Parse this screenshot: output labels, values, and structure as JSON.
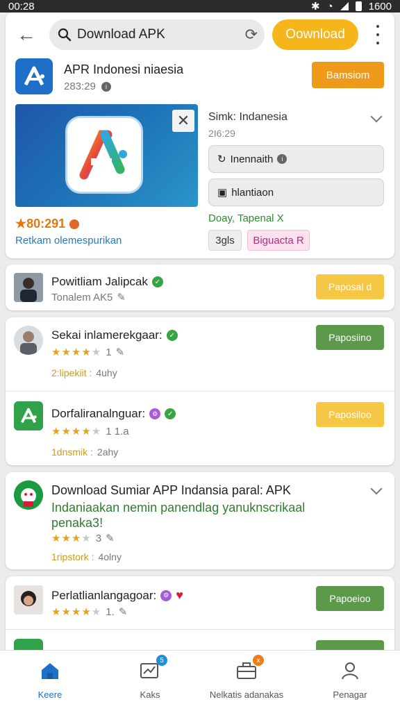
{
  "status_bar": {
    "time": "00:28",
    "battery_text": "1600"
  },
  "top_bar": {
    "search_value": "Download APK",
    "download_label": "Oownload"
  },
  "app": {
    "title": "APR Indonesi niaesia",
    "meta": "283:29",
    "action_label": "Bamsiom",
    "rating_text": "★80:291",
    "subtitle_link": "Retkam olemespurikan",
    "info_title": "Simk: Indanesia",
    "info_sub": "2I6:29",
    "field1": "Inennaith",
    "field2": "hlantiaon",
    "status_text": "Doay, Tapenal X",
    "chip1": "3gls",
    "chip2": "Biguacta R"
  },
  "list": [
    {
      "title": "Powitliam Jalipcak",
      "sub": "Tonalem AK5",
      "action": "Paposal d",
      "action_color": "#f6c744"
    },
    {
      "title": "Sekai inlamerekgaar:",
      "count": "1",
      "meta_key": "2:lipekiit :",
      "meta_val": "4uhy",
      "action": "Paposiino",
      "action_color": "#5c9a49"
    },
    {
      "title": "Dorfaliranalnguar:",
      "count": "1 1.a",
      "meta_key": "1dnsmik :",
      "meta_val": "2ahy",
      "action": "Paposiloo",
      "action_color": "#f6c744"
    },
    {
      "title": "Download Sumiar APP Indansia paral: APK",
      "desc": "Indaniaakan nemin panendlag yanuknscrikaal penaka3!",
      "count": "3",
      "meta_key": "1ripstork :",
      "meta_val": "4olny"
    },
    {
      "title": "Perlatlianlangagoar:",
      "count": "1.",
      "action": "Papoeioo",
      "action_color": "#5c9a49"
    }
  ],
  "bottom_nav": [
    {
      "label": "Keere",
      "icon": "home-icon",
      "badge": ""
    },
    {
      "label": "Kaks",
      "icon": "chart-icon",
      "badge": "5"
    },
    {
      "label": "Nelkatis adanakas",
      "icon": "briefcase-icon",
      "badge": "x"
    },
    {
      "label": "Penagar",
      "icon": "person-icon",
      "badge": ""
    }
  ],
  "colors": {
    "accent_blue": "#1f6fc9",
    "accent_yellow": "#f6b51b",
    "accent_orange": "#ef9a1a",
    "green": "#5c9a49"
  }
}
